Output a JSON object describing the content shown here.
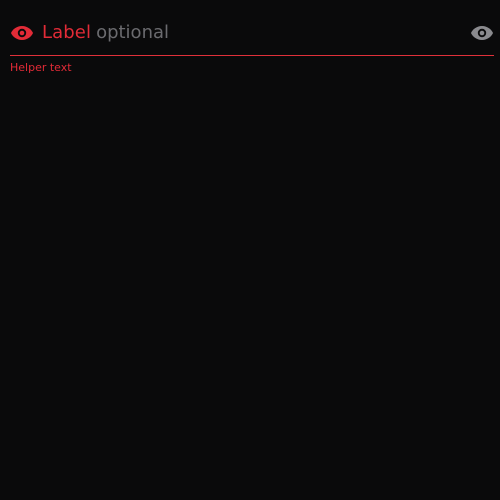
{
  "field": {
    "lead_icon": "eye-icon",
    "label": "Label",
    "optional": "optional",
    "trail_icon": "eye-icon",
    "helper": "Helper text"
  },
  "colors": {
    "background": "#0a0a0b",
    "error": "#e22b37",
    "muted": "#6b6b6f",
    "icon_muted": "#8a8a8e"
  }
}
